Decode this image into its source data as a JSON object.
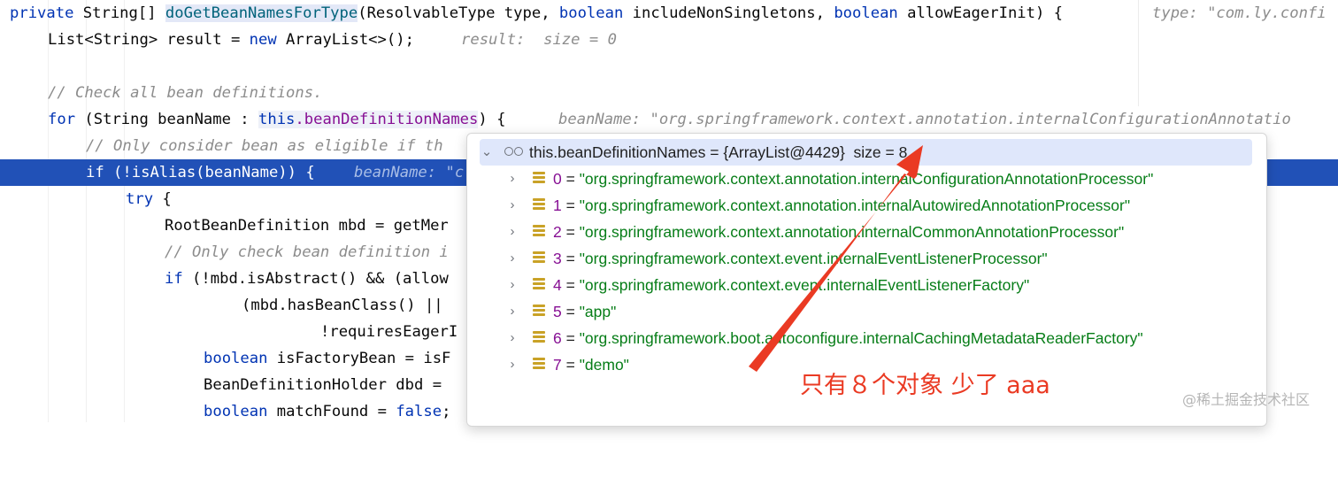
{
  "code": {
    "line1": {
      "kw1": "private",
      "t1": " String[] ",
      "method": "doGetBeanNamesForType",
      "t2": "(ResolvableType type, ",
      "kw2": "boolean",
      "t3": " includeNonSingletons, ",
      "kw3": "boolean",
      "t4": " allowEagerInit) {",
      "hint": "type: \"com.ly.confi"
    },
    "line2": {
      "t1": "List<String> result = ",
      "kw": "new",
      "t2": " ArrayList<>();",
      "hint": "result:  size = 0"
    },
    "line4": {
      "comment": "// Check all bean definitions."
    },
    "line5": {
      "kw": "for",
      "t1": " (String beanName : ",
      "this": "this",
      "fld": ".beanDefinitionNames",
      "t2": ") {",
      "hint": "beanName: \"org.springframework.context.annotation.internalConfigurationAnnotatio"
    },
    "line6": {
      "comment": "// Only consider bean as eligible if th"
    },
    "line7": {
      "kw": "if",
      "t1": " (!isAlias(beanName)) {",
      "hint": "beanName: \"c"
    },
    "line8": {
      "kw": "try",
      "t1": " {"
    },
    "line9": {
      "t1": "RootBeanDefinition mbd = getMer"
    },
    "line10": {
      "comment": "// Only check bean definition i"
    },
    "line11": {
      "kw": "if",
      "t1": " (!mbd.isAbstract() && (allow"
    },
    "line12": {
      "t1": "(mbd.hasBeanClass() ||"
    },
    "line13": {
      "t1": "!requiresEagerI"
    },
    "line14": {
      "kw": "boolean",
      "t1": " isFactoryBean = isF"
    },
    "line15": {
      "t1": "BeanDefinitionHolder dbd ="
    },
    "line16": {
      "kw": "boolean",
      "t1": " matchFound = ",
      "kw2": "false",
      "t2": ";"
    }
  },
  "popup": {
    "header": "this.beanDefinitionNames = {ArrayList@4429}  size = 8",
    "items": [
      {
        "index": "0",
        "value": "\"org.springframework.context.annotation.internalConfigurationAnnotationProcessor\""
      },
      {
        "index": "1",
        "value": "\"org.springframework.context.annotation.internalAutowiredAnnotationProcessor\""
      },
      {
        "index": "2",
        "value": "\"org.springframework.context.annotation.internalCommonAnnotationProcessor\""
      },
      {
        "index": "3",
        "value": "\"org.springframework.context.event.internalEventListenerProcessor\""
      },
      {
        "index": "4",
        "value": "\"org.springframework.context.event.internalEventListenerFactory\""
      },
      {
        "index": "5",
        "value": "\"app\""
      },
      {
        "index": "6",
        "value": "\"org.springframework.boot.autoconfigure.internalCachingMetadataReaderFactory\""
      },
      {
        "index": "7",
        "value": "\"demo\""
      }
    ],
    "equals": " = "
  },
  "annotation": "只有８个对象 少了 aaa",
  "watermark": "@稀土掘金技术社区",
  "colors": {
    "selection": "#2151b7",
    "annotation": "#ea3a23",
    "keyword": "#0033b3",
    "string": "#067d17",
    "field": "#871094"
  }
}
